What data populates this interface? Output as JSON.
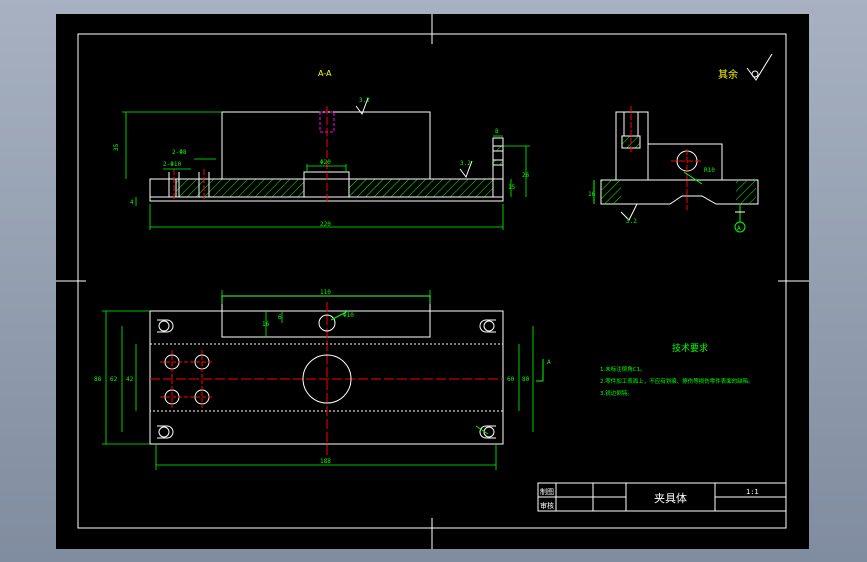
{
  "section_label": "A-A",
  "roughness_note": "其余",
  "roughness_values": [
    "3.2",
    "3.2",
    "3.2"
  ],
  "datum_label": "A",
  "section_arrow_label": "A",
  "dims": {
    "front_height": "35",
    "front_slot": "2-Φ8",
    "front_hole": "2-Φ10",
    "front_center": "Φ20",
    "front_total": "220",
    "front_right_top": "8",
    "front_right_h": "15",
    "front_right_h2": "26",
    "front_left_small": "4",
    "side_height": "16",
    "side_radius": "R10",
    "top_width": "110",
    "top_h": "16",
    "top_h2": "6",
    "top_hole": "Φ10",
    "plan_total": "188",
    "plan_h_outer": "88",
    "plan_h_mid": "62",
    "plan_h_inner": "42",
    "plan_right_a": "60",
    "plan_right_b": "80"
  },
  "notes": {
    "title": "技术要求",
    "items": [
      "1.未标注倒角C1。",
      "2.零件加工表面上，不应有划痕、擦伤等损伤零件表面的缺陷。",
      "3.锐边倒钝。"
    ]
  },
  "title_block": {
    "drawn_label": "制图",
    "checked_label": "审核",
    "part_name": "夹具体",
    "scale": "1:1"
  },
  "colors": {
    "background": "#000000",
    "outline": "#ffffff",
    "dimension": "#00ff00",
    "centerline": "#ff0000",
    "hidden": "#ff00ff",
    "text_yellow": "#ffff00",
    "notes_text": "#00ff00"
  }
}
